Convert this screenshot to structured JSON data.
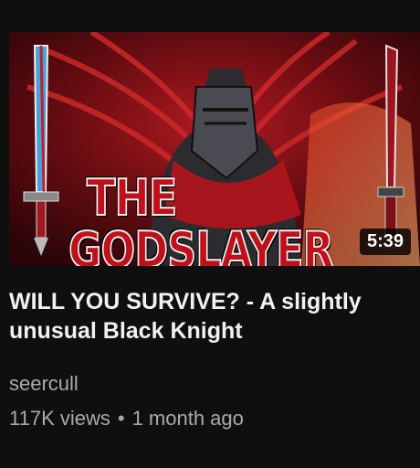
{
  "video": {
    "thumbnail_text_line1": "THE",
    "thumbnail_text_line2": "GODSLAYER",
    "duration": "5:39",
    "title": "WILL YOU SURVIVE? - A slightly unusual Black Knight",
    "channel": "seercull",
    "views": "117K views",
    "separator": "•",
    "age": "1 month ago"
  },
  "colors": {
    "background": "#0f0f0f",
    "thumbnail_red": "#c0101a",
    "meta_text": "#aaaaaa"
  }
}
